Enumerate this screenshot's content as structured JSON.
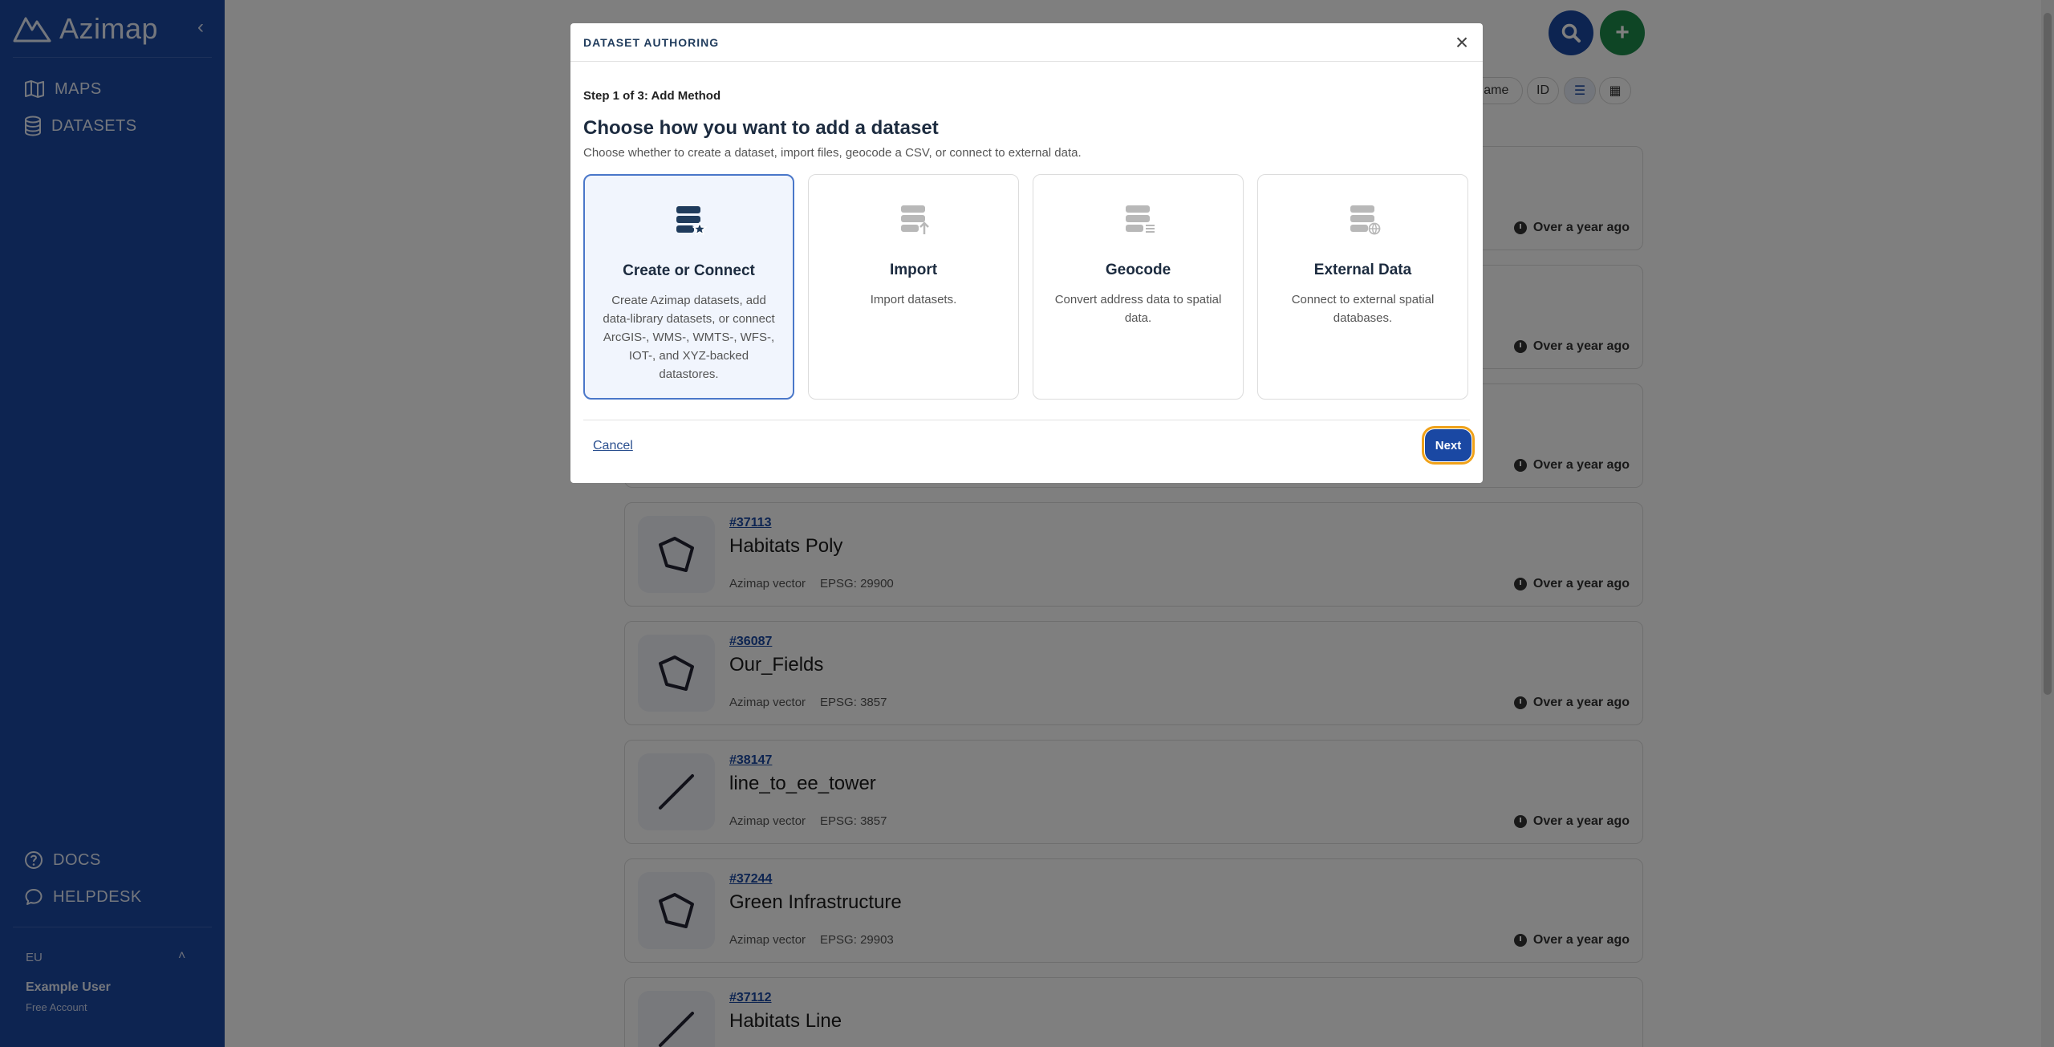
{
  "sidebar": {
    "brand": "Azimap",
    "nav": [
      {
        "label": "MAPS",
        "icon": "map-icon"
      },
      {
        "label": "DATASETS",
        "icon": "database-icon"
      }
    ],
    "bottom_nav": [
      {
        "label": "DOCS",
        "icon": "question-icon"
      },
      {
        "label": "HELPDESK",
        "icon": "chat-icon"
      }
    ],
    "region": "EU",
    "user": {
      "name": "Example User",
      "plan": "Free Account"
    }
  },
  "toolbar": {
    "sort_name": "Name",
    "sort_id": "ID"
  },
  "datasets": [
    {
      "id": "",
      "title": "",
      "type": "",
      "epsg": "",
      "time": "Over a year ago"
    },
    {
      "id": "",
      "title": "",
      "type": "",
      "epsg": "",
      "time": "Over a year ago"
    },
    {
      "id": "",
      "title": "",
      "type": "",
      "epsg": "",
      "time": "Over a year ago"
    },
    {
      "id": "#37113",
      "title": "Habitats Poly",
      "type": "Azimap vector",
      "epsg": "EPSG: 29900",
      "time": "Over a year ago"
    },
    {
      "id": "#36087",
      "title": "Our_Fields",
      "type": "Azimap vector",
      "epsg": "EPSG: 3857",
      "time": "Over a year ago"
    },
    {
      "id": "#38147",
      "title": "line_to_ee_tower",
      "type": "Azimap vector",
      "epsg": "EPSG: 3857",
      "time": "Over a year ago"
    },
    {
      "id": "#37244",
      "title": "Green Infrastructure",
      "type": "Azimap vector",
      "epsg": "EPSG: 29903",
      "time": "Over a year ago"
    },
    {
      "id": "#37112",
      "title": "Habitats Line",
      "type": "",
      "epsg": "",
      "time": ""
    }
  ],
  "modal": {
    "title": "DATASET AUTHORING",
    "step": "Step 1 of 3: Add Method",
    "heading": "Choose how you want to add a dataset",
    "subheading": "Choose whether to create a dataset, import files, geocode a CSV, or connect to external data.",
    "options": [
      {
        "title": "Create or Connect",
        "desc": "Create Azimap datasets, add data-library datasets, or connect ArcGIS-, WMS-, WMTS-, WFS-, IOT-, and XYZ-backed datastores.",
        "selected": true
      },
      {
        "title": "Import",
        "desc": "Import datasets.",
        "selected": false
      },
      {
        "title": "Geocode",
        "desc": "Convert address data to spatial data.",
        "selected": false
      },
      {
        "title": "External Data",
        "desc": "Connect to external spatial databases.",
        "selected": false
      }
    ],
    "cancel_label": "Cancel",
    "next_label": "Next"
  }
}
